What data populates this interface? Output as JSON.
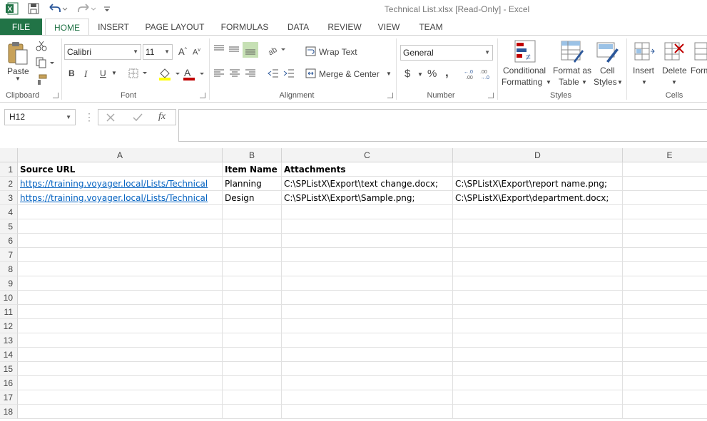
{
  "window": {
    "title": "Technical List.xlsx  [Read-Only] - Excel"
  },
  "tabs": {
    "file": "FILE",
    "items": [
      "HOME",
      "INSERT",
      "PAGE LAYOUT",
      "FORMULAS",
      "DATA",
      "REVIEW",
      "VIEW",
      "TEAM"
    ],
    "active": "HOME"
  },
  "ribbon": {
    "clipboard": {
      "paste": "Paste",
      "label": "Clipboard"
    },
    "font": {
      "name": "Calibri",
      "size": "11",
      "bold": "B",
      "italic": "I",
      "underline": "U",
      "label": "Font"
    },
    "alignment": {
      "wrap_text": "Wrap Text",
      "merge_center": "Merge & Center",
      "label": "Alignment"
    },
    "number": {
      "format": "General",
      "currency": "$",
      "percent": "%",
      "comma": ",",
      "label": "Number"
    },
    "styles": {
      "conditional_1": "Conditional",
      "conditional_2": "Formatting",
      "format_table_1": "Format as",
      "format_table_2": "Table",
      "cell_styles_1": "Cell",
      "cell_styles_2": "Styles",
      "label": "Styles"
    },
    "cells": {
      "insert": "Insert",
      "delete": "Delete",
      "format": "Form",
      "label": "Cells"
    }
  },
  "formula_bar": {
    "name_box": "H12",
    "fx": "fx",
    "value": ""
  },
  "sheet": {
    "columns": [
      "A",
      "B",
      "C",
      "D",
      "E"
    ],
    "rows": [
      "1",
      "2",
      "3",
      "4",
      "5",
      "6",
      "7",
      "8",
      "9",
      "10",
      "11",
      "12",
      "13",
      "14",
      "15",
      "16",
      "17",
      "18"
    ],
    "headers": [
      "Source URL",
      "Item Name",
      "Attachments"
    ],
    "data": [
      {
        "url": "https://training.voyager.local/Lists/Technical",
        "item": "Planning",
        "att1": "C:\\SPListX\\Export\\text change.docx;",
        "att2": "C:\\SPListX\\Export\\report name.png;"
      },
      {
        "url": "https://training.voyager.local/Lists/Technical",
        "item": "Design",
        "att1": "C:\\SPListX\\Export\\Sample.png;",
        "att2": "C:\\SPListX\\Export\\department.docx;"
      }
    ]
  },
  "colors": {
    "accent": "#217346",
    "link": "#0563c1",
    "font_color_bar": "#c00000",
    "highlight_bar": "#ffff00"
  }
}
